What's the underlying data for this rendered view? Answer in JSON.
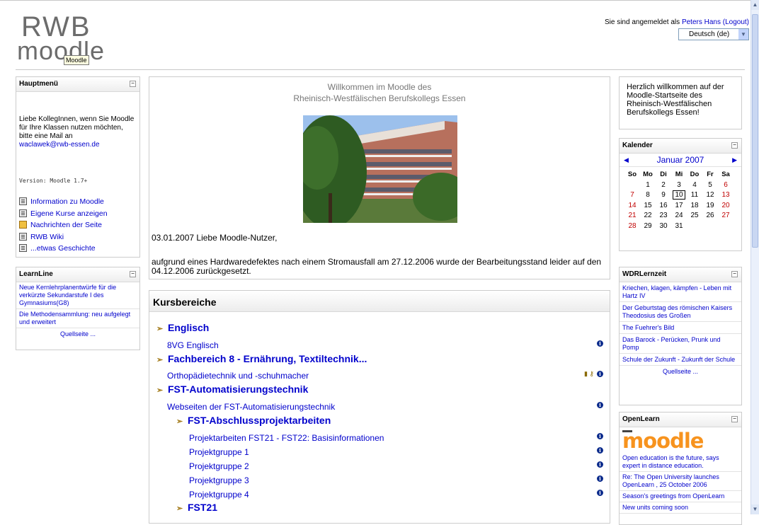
{
  "header": {
    "logo_top": "RWB",
    "logo_bottom": "moodle",
    "logo_tooltip": "Moodle",
    "login_prefix": "Sie sind angemeldet als ",
    "login_user": "Peters Hans",
    "login_logout": "(Logout)",
    "language": "Deutsch (de)"
  },
  "hauptmenu": {
    "title": "Hauptmenü",
    "intro": "Liebe KollegInnen, wenn Sie Moodle für Ihre Klassen nutzen möchten, bitte eine Mail an",
    "email": "waclawek@rwb-essen.de",
    "version": "Version: Moodle 1.7+",
    "items": [
      {
        "label": "Information zu Moodle",
        "icon": "document-icon"
      },
      {
        "label": "Eigene Kurse anzeigen",
        "icon": "document-icon"
      },
      {
        "label": "Nachrichten der Seite",
        "icon": "forum-icon"
      },
      {
        "label": "RWB Wiki",
        "icon": "document-icon"
      },
      {
        "label": "...etwas Geschichte",
        "icon": "document-icon"
      }
    ]
  },
  "learnline": {
    "title": "LearnLine",
    "items": [
      "Neue Kernlehrplanentwürfe für die verkürzte Sekundarstufe I des Gymnasiums(G8)",
      "Die Methodensammlung: neu aufgelegt und erweitert"
    ],
    "source": "Quellseite ..."
  },
  "welcome": {
    "line1": "Willkommen im Moodle des",
    "line2": "Rheinisch-Westfälischen Berufskollegs Essen",
    "p1": "03.01.2007 Liebe Moodle-Nutzer,",
    "p2": "aufgrund eines Hardwaredefektes nach einem Stromausfall am 27.12.2006 wurde der Bearbeitungsstand leider auf den 04.12.2006 zurückgesetzt."
  },
  "kurs": {
    "title": "Kursbereiche",
    "rows": [
      {
        "kind": "cat",
        "label": "Englisch",
        "indent": 0
      },
      {
        "kind": "course",
        "label": "8VG Englisch",
        "indent": 0,
        "info": true
      },
      {
        "kind": "cat",
        "label": "Fachbereich 8 - Ernährung, Textiltechnik...",
        "indent": 0
      },
      {
        "kind": "course",
        "label": "Orthopädietechnik und -schuhmacher",
        "indent": 0,
        "info": true,
        "extra": "guest-key"
      },
      {
        "kind": "cat",
        "label": "FST-Automatisierungstechnik",
        "indent": 0
      },
      {
        "kind": "course",
        "label": "Webseiten der FST-Automatisierungstechnik",
        "indent": 0,
        "info": true
      },
      {
        "kind": "cat",
        "label": "FST-Abschlussprojektarbeiten",
        "indent": 1
      },
      {
        "kind": "course",
        "label": "Projektarbeiten FST21 - FST22: Basisinformationen",
        "indent": 1,
        "info": true
      },
      {
        "kind": "course",
        "label": "Projektgruppe 1",
        "indent": 1,
        "info": true
      },
      {
        "kind": "course",
        "label": "Projektgruppe 2",
        "indent": 1,
        "info": true
      },
      {
        "kind": "course",
        "label": "Projektgruppe 3",
        "indent": 1,
        "info": true
      },
      {
        "kind": "course",
        "label": "Projektgruppe 4",
        "indent": 1,
        "info": true
      },
      {
        "kind": "cat",
        "label": "FST21",
        "indent": 1
      }
    ]
  },
  "herzlich": {
    "text": "Herzlich willkommen auf der Moodle-Startseite des Rheinisch-Westfälischen Berufskollegs Essen!"
  },
  "kalender": {
    "title": "Kalender",
    "month": "Januar 2007",
    "weekdays": [
      "So",
      "Mo",
      "Di",
      "Mi",
      "Do",
      "Fr",
      "Sa"
    ],
    "weeks": [
      [
        "",
        "1",
        "2",
        "3",
        "4",
        "5",
        "6"
      ],
      [
        "7",
        "8",
        "9",
        "10",
        "11",
        "12",
        "13"
      ],
      [
        "14",
        "15",
        "16",
        "17",
        "18",
        "19",
        "20"
      ],
      [
        "21",
        "22",
        "23",
        "24",
        "25",
        "26",
        "27"
      ],
      [
        "28",
        "29",
        "30",
        "31",
        "",
        "",
        ""
      ]
    ],
    "today": "10"
  },
  "wdr": {
    "title": "WDRLernzeit",
    "items": [
      "Kriechen, klagen, kämpfen - Leben mit Hartz IV",
      "Der Geburtstag des römischen Kaisers Theodosius des Großen",
      "The Fuehrer's Bild",
      "Das Barock - Perücken, Prunk und Pomp",
      "Schule der Zukunft - Zukunft der Schule"
    ],
    "source": "Quellseite ..."
  },
  "openlearn": {
    "title": "OpenLearn",
    "logo": "moodle",
    "items": [
      "Open education is the future, says expert in distance education.",
      "Re: The Open University launches OpenLearn , 25 October 2006",
      "Season's greetings from OpenLearn",
      "New units coming soon"
    ]
  },
  "colors": {
    "link": "#0000cc",
    "weekend": "#c00000",
    "moodle_orange": "#f7931e"
  }
}
